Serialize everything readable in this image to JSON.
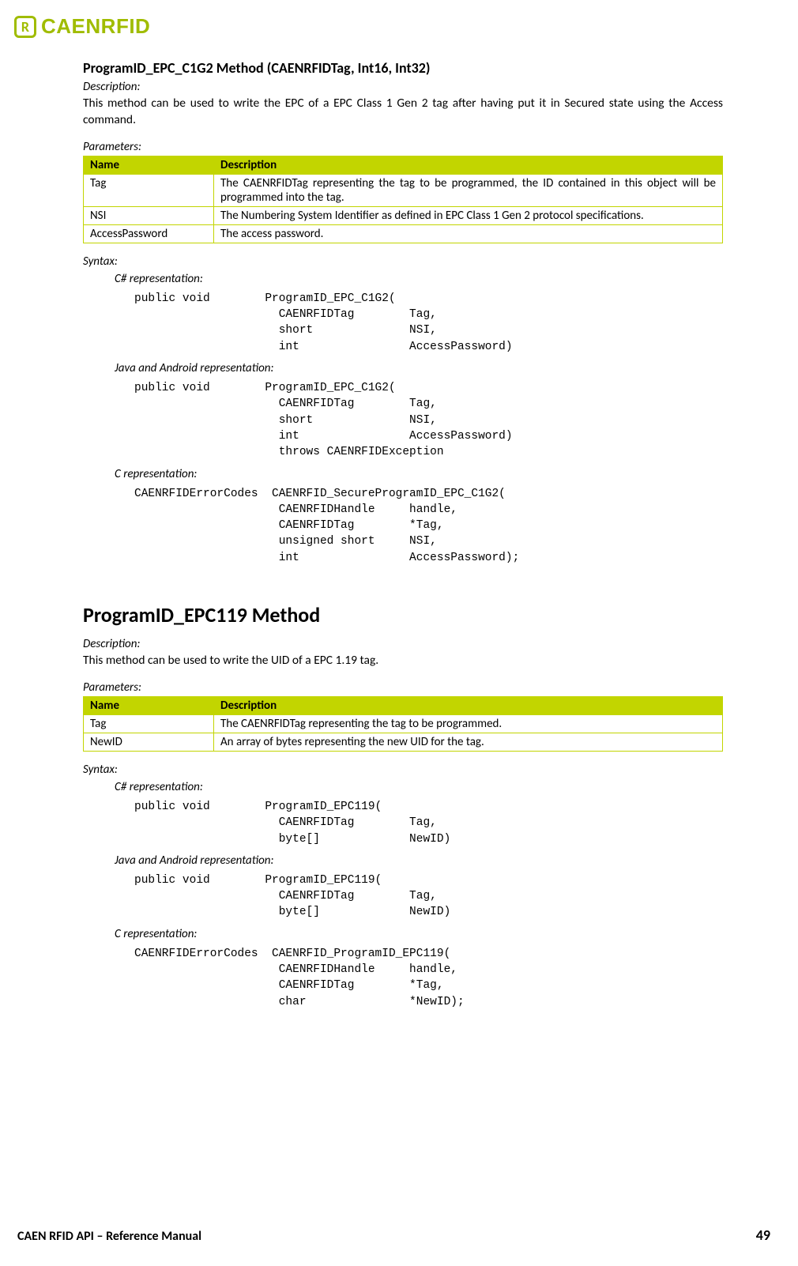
{
  "brand": {
    "icon_letter": "R",
    "text": "CAENRFID"
  },
  "method1": {
    "title": "ProgramID_EPC_C1G2 Method (CAENRFIDTag, Int16, Int32)",
    "desc_label": "Description:",
    "desc_text": "This method can be used to write the EPC of a EPC Class 1 Gen 2 tag after having put it in Secured state using the Access command.",
    "params_label": "Parameters:",
    "table": {
      "h1": "Name",
      "h2": "Description",
      "rows": [
        {
          "name": "Tag",
          "desc": "The CAENRFIDTag representing the tag to be programmed, the ID contained in this object will be programmed into the tag."
        },
        {
          "name": "NSI",
          "desc": "The Numbering System Identifier as defined in EPC Class 1 Gen 2 protocol specifications."
        },
        {
          "name": "AccessPassword",
          "desc": "The access password."
        }
      ]
    },
    "syntax_label": "Syntax:",
    "rep1_label": "C# representation:",
    "rep1_code": "public void        ProgramID_EPC_C1G2(\n                     CAENRFIDTag        Tag,\n                     short              NSI,\n                     int                AccessPassword)",
    "rep2_label": "Java and Android representation:",
    "rep2_code": "public void        ProgramID_EPC_C1G2(\n                     CAENRFIDTag        Tag,\n                     short              NSI,\n                     int                AccessPassword)\n                     throws CAENRFIDException",
    "rep3_label": "C representation:",
    "rep3_code": "CAENRFIDErrorCodes  CAENRFID_SecureProgramID_EPC_C1G2(\n                     CAENRFIDHandle     handle,\n                     CAENRFIDTag        *Tag,\n                     unsigned short     NSI,\n                     int                AccessPassword);"
  },
  "method2": {
    "title": "ProgramID_EPC119 Method",
    "desc_label": "Description:",
    "desc_text": "This method can be used to write the UID of a EPC 1.19 tag.",
    "params_label": "Parameters:",
    "table": {
      "h1": "Name",
      "h2": "Description",
      "rows": [
        {
          "name": "Tag",
          "desc": "The CAENRFIDTag representing the tag to be programmed."
        },
        {
          "name": "NewID",
          "desc": "An array of bytes representing the new UID for the tag."
        }
      ]
    },
    "syntax_label": "Syntax:",
    "rep1_label": "C# representation:",
    "rep1_code": "public void        ProgramID_EPC119(\n                     CAENRFIDTag        Tag,\n                     byte[]             NewID)",
    "rep2_label": "Java and Android representation:",
    "rep2_code": "public void        ProgramID_EPC119(\n                     CAENRFIDTag        Tag,\n                     byte[]             NewID)",
    "rep3_label": "C representation:",
    "rep3_code": "CAENRFIDErrorCodes  CAENRFID_ProgramID_EPC119(\n                     CAENRFIDHandle     handle,\n                     CAENRFIDTag        *Tag,\n                     char               *NewID);"
  },
  "footer": {
    "left": "CAEN RFID API – Reference Manual",
    "right": "49"
  }
}
